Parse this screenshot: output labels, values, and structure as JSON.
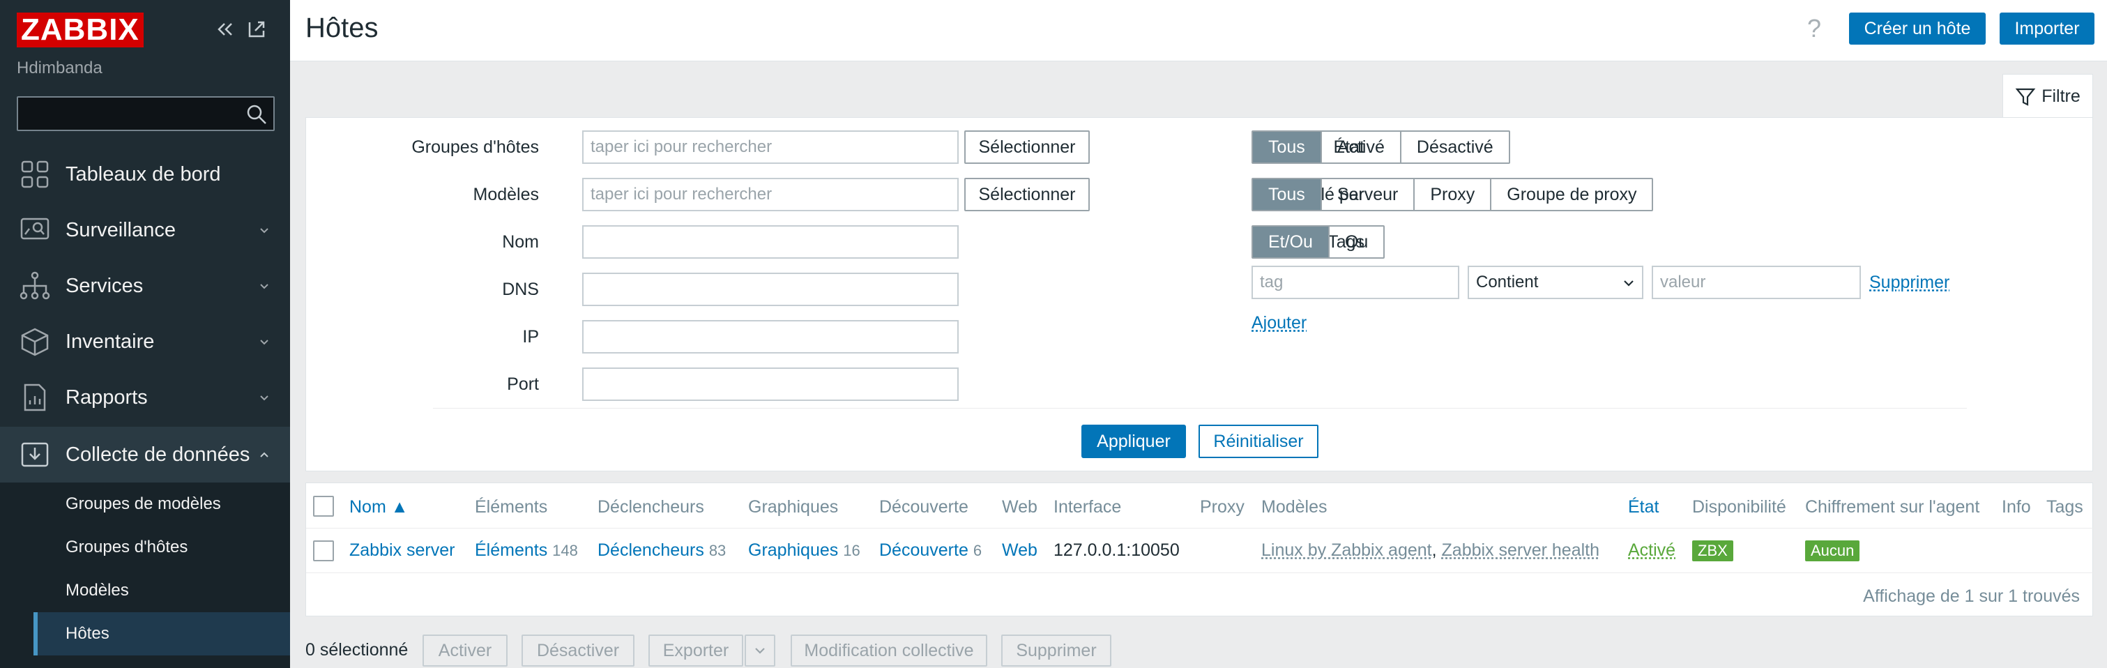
{
  "brand": "ZABBIX",
  "user": "Hdimbanda",
  "colors": {
    "brand_red": "#d40000",
    "sidebar_bg": "#1f2c33",
    "primary": "#0275b8",
    "seg_active": "#768d99",
    "status_green": "#59a83b"
  },
  "sidebar": {
    "items": [
      {
        "label": "Tableaux de bord",
        "icon": "dashboard-icon"
      },
      {
        "label": "Surveillance",
        "icon": "monitoring-icon"
      },
      {
        "label": "Services",
        "icon": "services-icon"
      },
      {
        "label": "Inventaire",
        "icon": "inventory-icon"
      },
      {
        "label": "Rapports",
        "icon": "reports-icon"
      },
      {
        "label": "Collecte de données",
        "icon": "data-collection-icon"
      }
    ],
    "sub": [
      "Groupes de modèles",
      "Groupes d'hôtes",
      "Modèles",
      "Hôtes"
    ]
  },
  "header": {
    "title": "Hôtes",
    "help": "?",
    "create_label": "Créer un hôte",
    "import_label": "Importer"
  },
  "filter": {
    "tab_label": "Filtre",
    "host_groups_label": "Groupes d'hôtes",
    "templates_label": "Modèles",
    "name_label": "Nom",
    "dns_label": "DNS",
    "ip_label": "IP",
    "port_label": "Port",
    "search_placeholder": "taper ici pour rechercher",
    "select_label": "Sélectionner",
    "status_label": "État",
    "status_opts": [
      "Tous",
      "Activé",
      "Désactivé"
    ],
    "monitored_label": "Surveillé par",
    "monitored_opts": [
      "Tous",
      "Serveur",
      "Proxy",
      "Groupe de proxy"
    ],
    "tags_label": "Tags",
    "tags_opts": [
      "Et/Ou",
      "Ou"
    ],
    "tag_placeholder": "tag",
    "operator": "Contient",
    "value_placeholder": "valeur",
    "remove_label": "Supprimer",
    "add_label": "Ajouter",
    "apply_label": "Appliquer",
    "reset_label": "Réinitialiser"
  },
  "table": {
    "columns": [
      "Nom ▲",
      "Éléments",
      "Déclencheurs",
      "Graphiques",
      "Découverte",
      "Web",
      "Interface",
      "Proxy",
      "Modèles",
      "État",
      "Disponibilité",
      "Chiffrement sur l'agent",
      "Info",
      "Tags"
    ],
    "row": {
      "name": "Zabbix server",
      "items": "Éléments",
      "items_count": "148",
      "triggers": "Déclencheurs",
      "triggers_count": "83",
      "graphs": "Graphiques",
      "graphs_count": "16",
      "discovery": "Découverte",
      "discovery_count": "6",
      "web": "Web",
      "interface": "127.0.0.1:10050",
      "template1": "Linux by Zabbix agent",
      "sep": ",",
      "template2": "Zabbix server health",
      "status": "Activé",
      "availability": "ZBX",
      "encryption": "Aucun"
    },
    "footer": "Affichage de 1 sur 1 trouvés"
  },
  "actions": {
    "selected": "0 sélectionné",
    "enable": "Activer",
    "disable": "Désactiver",
    "export": "Exporter",
    "mass_update": "Modification collective",
    "delete": "Supprimer"
  }
}
